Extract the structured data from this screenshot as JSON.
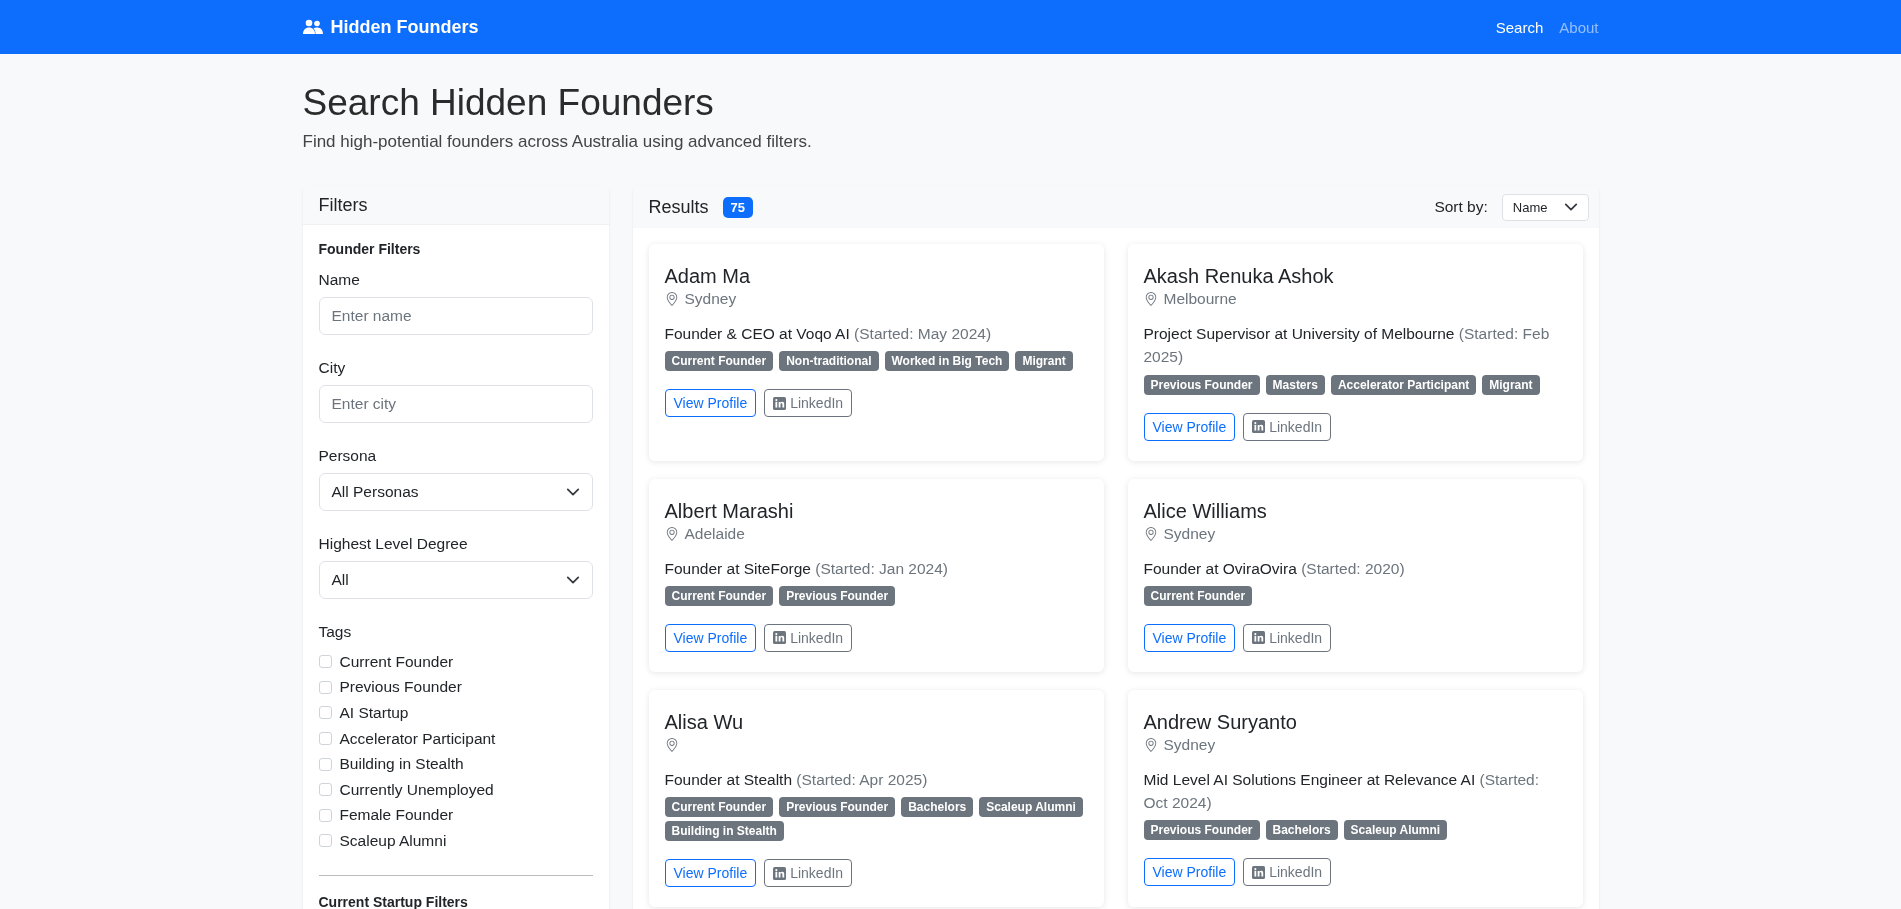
{
  "navbar": {
    "brand": "Hidden Founders",
    "links": [
      {
        "label": "Search",
        "selected": true
      },
      {
        "label": "About",
        "selected": false
      }
    ]
  },
  "title": "Search Hidden Founders",
  "subtitle": "Find high-potential founders across Australia using advanced filters.",
  "filters": {
    "title": "Filters",
    "section": "Founder Filters",
    "fields": [
      {
        "kind": "input",
        "label": "Name",
        "placeholder": "Enter name"
      },
      {
        "kind": "input",
        "label": "City",
        "placeholder": "Enter city"
      },
      {
        "kind": "select",
        "label": "Persona",
        "value": "All Personas"
      },
      {
        "kind": "select",
        "label": "Highest Level Degree",
        "value": "All"
      }
    ],
    "tags": {
      "label": "Tags",
      "items": [
        {
          "label": "Current Founder",
          "checked": false
        },
        {
          "label": "Previous Founder",
          "checked": false
        },
        {
          "label": "AI Startup",
          "checked": false
        },
        {
          "label": "Accelerator Participant",
          "checked": false
        },
        {
          "label": "Building in Stealth",
          "checked": false
        },
        {
          "label": "Currently Unemployed",
          "checked": false
        },
        {
          "label": "Female Founder",
          "checked": false
        },
        {
          "label": "Scaleup Alumni",
          "checked": false
        }
      ]
    },
    "next_section": "Current Startup Filters"
  },
  "results": {
    "title": "Results",
    "count": "75",
    "sort_label": "Sort by:",
    "sort_value": "Name",
    "cards": [
      {
        "name": "Adam Ma",
        "city": "Sydney",
        "role": "Founder & CEO at Voqo AI",
        "started": "(Started: May 2024)",
        "tags": [
          "Current Founder",
          "Non-traditional",
          "Worked in Big Tech",
          "Migrant"
        ],
        "actions": [
          "View Profile",
          "LinkedIn"
        ]
      },
      {
        "name": "Akash Renuka Ashok",
        "city": "Melbourne",
        "role": "Project Supervisor at University of Melbourne",
        "started": "(Started: Feb 2025)",
        "tags": [
          "Previous Founder",
          "Masters",
          "Accelerator Participant",
          "Migrant"
        ],
        "actions": [
          "View Profile",
          "LinkedIn"
        ]
      },
      {
        "name": "Albert Marashi",
        "city": "Adelaide",
        "role": "Founder at SiteForge",
        "started": "(Started: Jan 2024)",
        "tags": [
          "Current Founder",
          "Previous Founder"
        ],
        "actions": [
          "View Profile",
          "LinkedIn"
        ]
      },
      {
        "name": "Alice Williams",
        "city": "Sydney",
        "role": "Founder at OviraOvira",
        "started": "(Started: 2020)",
        "tags": [
          "Current Founder"
        ],
        "actions": [
          "View Profile",
          "LinkedIn"
        ]
      },
      {
        "name": "Alisa Wu",
        "role": "Founder at Stealth",
        "started": "(Started: Apr 2025)",
        "tags": [
          "Current Founder",
          "Previous Founder",
          "Bachelors",
          "Scaleup Alumni",
          "Building in Stealth"
        ],
        "actions": [
          "View Profile",
          "LinkedIn"
        ]
      },
      {
        "name": "Andrew Suryanto",
        "city": "Sydney",
        "role": "Mid Level AI Solutions Engineer at Relevance AI",
        "started": "(Started: Oct 2024)",
        "tags": [
          "Previous Founder",
          "Bachelors",
          "Scaleup Alumni"
        ],
        "actions": [
          "View Profile",
          "LinkedIn"
        ]
      }
    ]
  }
}
